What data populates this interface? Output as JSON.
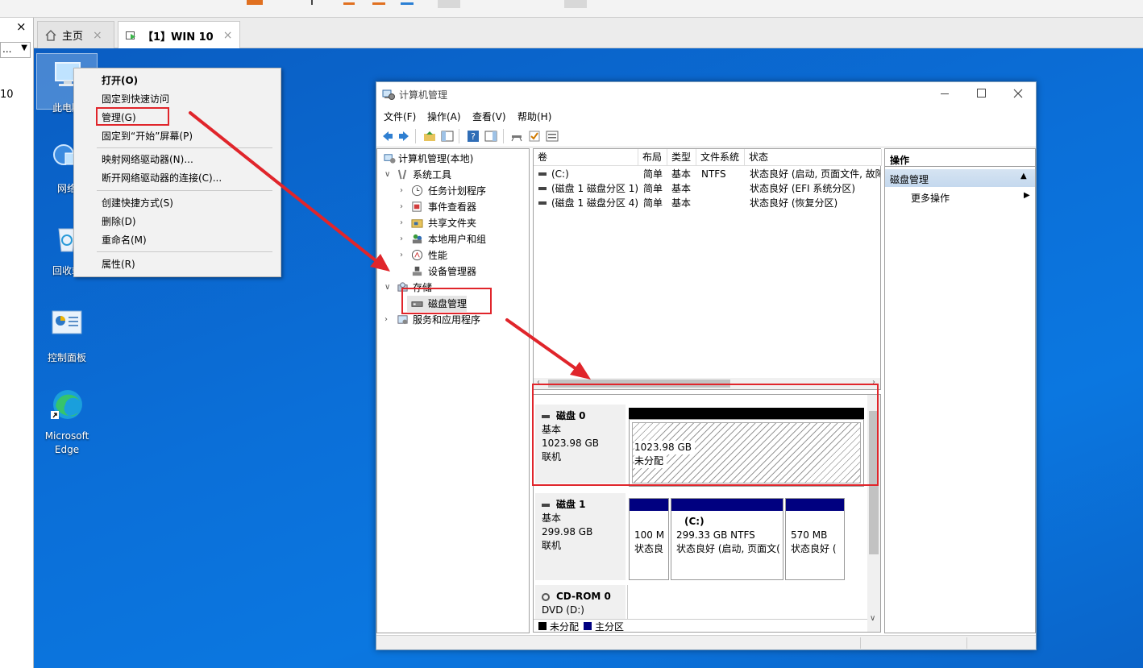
{
  "desktop": {
    "icons": [
      {
        "label": "此电脑"
      },
      {
        "label": "网络"
      },
      {
        "label": "回收站"
      },
      {
        "label": "控制面板"
      },
      {
        "label": "Microsoft Edge"
      }
    ]
  },
  "host": {
    "left_close": "×",
    "left_select": "...",
    "left_text": "10",
    "tabs": [
      {
        "label": "主页",
        "close": "×"
      },
      {
        "label": "【1】WIN 10",
        "close": "×"
      }
    ]
  },
  "context_menu": {
    "items": [
      "打开(O)",
      "固定到快速访问",
      "管理(G)",
      "固定到“开始”屏幕(P)",
      "映射网络驱动器(N)...",
      "断开网络驱动器的连接(C)...",
      "创建快捷方式(S)",
      "删除(D)",
      "重命名(M)",
      "属性(R)"
    ]
  },
  "computer_management": {
    "title": "计算机管理",
    "menu": [
      "文件(F)",
      "操作(A)",
      "查看(V)",
      "帮助(H)"
    ],
    "tree": {
      "root": "计算机管理(本地)",
      "system_tools": "系统工具",
      "task_scheduler": "任务计划程序",
      "event_viewer": "事件查看器",
      "shared_folders": "共享文件夹",
      "local_users": "本地用户和组",
      "performance": "性能",
      "device_manager": "设备管理器",
      "storage": "存储",
      "disk_management": "磁盘管理",
      "services": "服务和应用程序"
    },
    "volume_columns": [
      "卷",
      "布局",
      "类型",
      "文件系统",
      "状态"
    ],
    "volumes": [
      {
        "name": "(C:)",
        "layout": "简单",
        "type": "基本",
        "fs": "NTFS",
        "status": "状态良好 (启动, 页面文件, 故障"
      },
      {
        "name": "(磁盘 1 磁盘分区 1)",
        "layout": "简单",
        "type": "基本",
        "fs": "",
        "status": "状态良好 (EFI 系统分区)"
      },
      {
        "name": "(磁盘 1 磁盘分区 4)",
        "layout": "简单",
        "type": "基本",
        "fs": "",
        "status": "状态良好 (恢复分区)"
      }
    ],
    "disks": [
      {
        "name": "磁盘 0",
        "type": "基本",
        "size": "1023.98 GB",
        "state": "联机",
        "partitions": [
          {
            "line1": "1023.98 GB",
            "line2": "未分配"
          }
        ]
      },
      {
        "name": "磁盘 1",
        "type": "基本",
        "size": "299.98 GB",
        "state": "联机",
        "partitions": [
          {
            "label": "",
            "line1": "100 M",
            "line2": "状态良"
          },
          {
            "label": "(C:)",
            "line1": "299.33 GB NTFS",
            "line2": "状态良好 (启动, 页面文("
          },
          {
            "label": "",
            "line1": "570 MB",
            "line2": "状态良好 ("
          }
        ]
      },
      {
        "name": "CD-ROM 0",
        "type": "DVD (D:)"
      }
    ],
    "legend": [
      {
        "label": "未分配",
        "color": "#000000"
      },
      {
        "label": "主分区",
        "color": "#000080"
      }
    ],
    "actions": {
      "header": "操作",
      "section": "磁盘管理",
      "more": "更多操作"
    }
  },
  "colors": {
    "desktop": "#0b6fd8",
    "annotation": "#e0252b",
    "partition_primary": "#000080"
  }
}
